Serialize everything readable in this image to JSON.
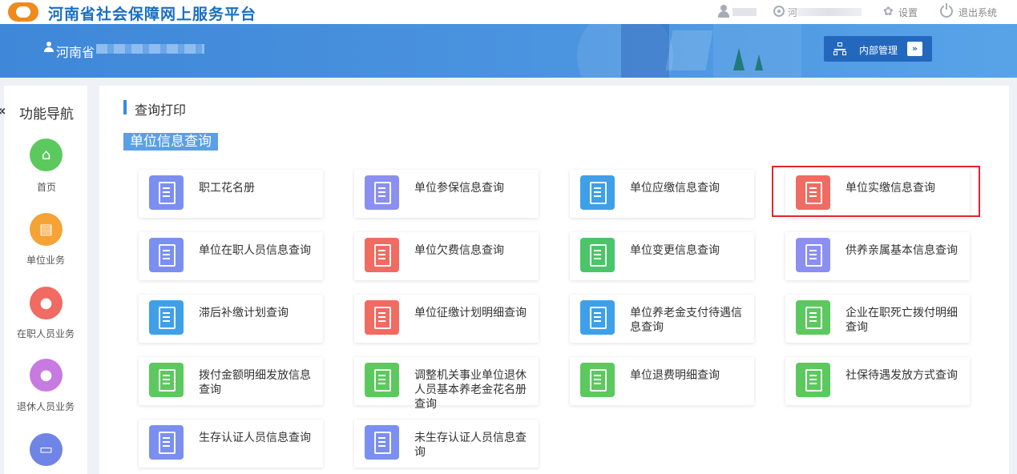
{
  "topbar": {
    "app_title": "河南省社会保障网上服务平台",
    "location_prefix": "河",
    "location_suffix": ".",
    "settings_label": "设置",
    "logout_label": "退出系统"
  },
  "banner": {
    "org_name": "河南省",
    "org_suffix": ".",
    "internal_mgmt_label": "内部管理",
    "arrow_glyph": "»"
  },
  "sidebar": {
    "collapse_glyph": "«",
    "title": "功能导航",
    "items": [
      {
        "label": "首页",
        "icon": "home-icon",
        "color": "#5cc95e"
      },
      {
        "label": "单位业务",
        "icon": "building-icon",
        "color": "#f5a337"
      },
      {
        "label": "在职人员业务",
        "icon": "people-icon",
        "color": "#f06b62"
      },
      {
        "label": "退休人员业务",
        "icon": "person-icon",
        "color": "#c77ae0"
      },
      {
        "label": "",
        "icon": "printer-icon",
        "color": "#6f85e6"
      }
    ]
  },
  "main": {
    "section_title": "查询打印",
    "subsection_title": "单位信息查询",
    "cards": [
      {
        "label": "职工花名册",
        "icon": "roster-icon",
        "color": "#7b8ff0"
      },
      {
        "label": "单位参保信息查询",
        "icon": "clipboard-icon",
        "color": "#8b8ff0"
      },
      {
        "label": "单位应缴信息查询",
        "icon": "yen-invoice-icon",
        "color": "#3fa0e8"
      },
      {
        "label": "单位实缴信息查询",
        "icon": "bill-icon",
        "color": "#f06b62"
      },
      {
        "label": "单位在职人员信息查询",
        "icon": "office-building-icon",
        "color": "#7b8ff0"
      },
      {
        "label": "单位欠费信息查询",
        "icon": "printer-icon",
        "color": "#f06b62"
      },
      {
        "label": "单位变更信息查询",
        "icon": "document-change-icon",
        "color": "#4cc46a"
      },
      {
        "label": "供养亲属基本信息查询",
        "icon": "clipboard-icon",
        "color": "#8b8ff0"
      },
      {
        "label": "滞后补缴计划查询",
        "icon": "schedule-icon",
        "color": "#3fa0e8"
      },
      {
        "label": "单位征缴计划明细查询",
        "icon": "checklist-icon",
        "color": "#f06b62"
      },
      {
        "label": "单位养老金支付待遇信息查询",
        "icon": "calculator-icon",
        "color": "#3fa0e8"
      },
      {
        "label": "企业在职死亡拨付明细查询",
        "icon": "heart-icon",
        "color": "#5cc95e"
      },
      {
        "label": "拨付金额明细发放信息查询",
        "icon": "receipt-icon",
        "color": "#5cc95e"
      },
      {
        "label": "调整机关事业单位退休人员基本养老金花名册查询",
        "icon": "money-bag-icon",
        "color": "#5cc95e"
      },
      {
        "label": "单位退费明细查询",
        "icon": "refund-icon",
        "color": "#5cc95e"
      },
      {
        "label": "社保待遇发放方式查询",
        "icon": "money-bag-icon",
        "color": "#5cc95e"
      },
      {
        "label": "生存认证人员信息查询",
        "icon": "verify-doc-icon",
        "color": "#7b8ff0"
      },
      {
        "label": "未生存认证人员信息查询",
        "icon": "verify-doc-icon",
        "color": "#7b8ff0"
      }
    ]
  }
}
